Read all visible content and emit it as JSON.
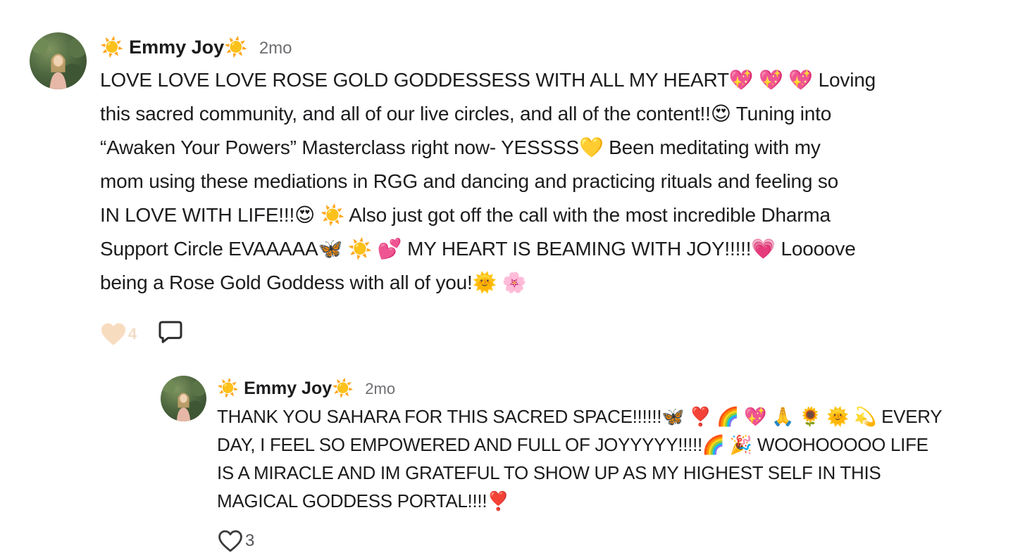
{
  "comments": [
    {
      "author": "☀️ Emmy Joy☀️",
      "time": "2mo",
      "text": "LOVE LOVE LOVE ROSE GOLD GODDESSESS WITH ALL MY HEART💖 💖 💖  Loving\nthis sacred community, and all of our live circles, and all of the content!!😍 Tuning into\n“Awaken Your Powers” Masterclass right now- YESSSS💛  Been meditating with my\nmom using these mediations in RGG and dancing and practicing rituals and feeling so\nIN LOVE WITH LIFE!!!😍 ☀️  Also just got off the call with the most incredible Dharma\nSupport Circle EVAAAAA🦋 ☀️ 💕  MY HEART IS BEAMING WITH JOY!!!!!💗  Loooove\nbeing a Rose Gold Goddess with all of you!🌞 🌸",
      "likes": "4",
      "liked": true
    },
    {
      "author": "☀️ Emmy Joy☀️",
      "time": "2mo",
      "text": "THANK YOU SAHARA FOR THIS SACRED SPACE!!!!!!🦋 ❣️ 🌈 💖 🙏 🌻 🌞 💫  EVERY\nDAY, I FEEL SO EMPOWERED AND FULL OF JOYYYYY!!!!!🌈 🎉  WOOHOOOOO LIFE\nIS A MIRACLE AND IM GRATEFUL TO SHOW UP AS MY HIGHEST SELF IN THIS\nMAGICAL GODDESS PORTAL!!!!❣️",
      "likes": "3",
      "liked": false
    }
  ],
  "colors": {
    "liked_heart": "#f8dcc0",
    "outline_icon": "#3a3a3c"
  }
}
